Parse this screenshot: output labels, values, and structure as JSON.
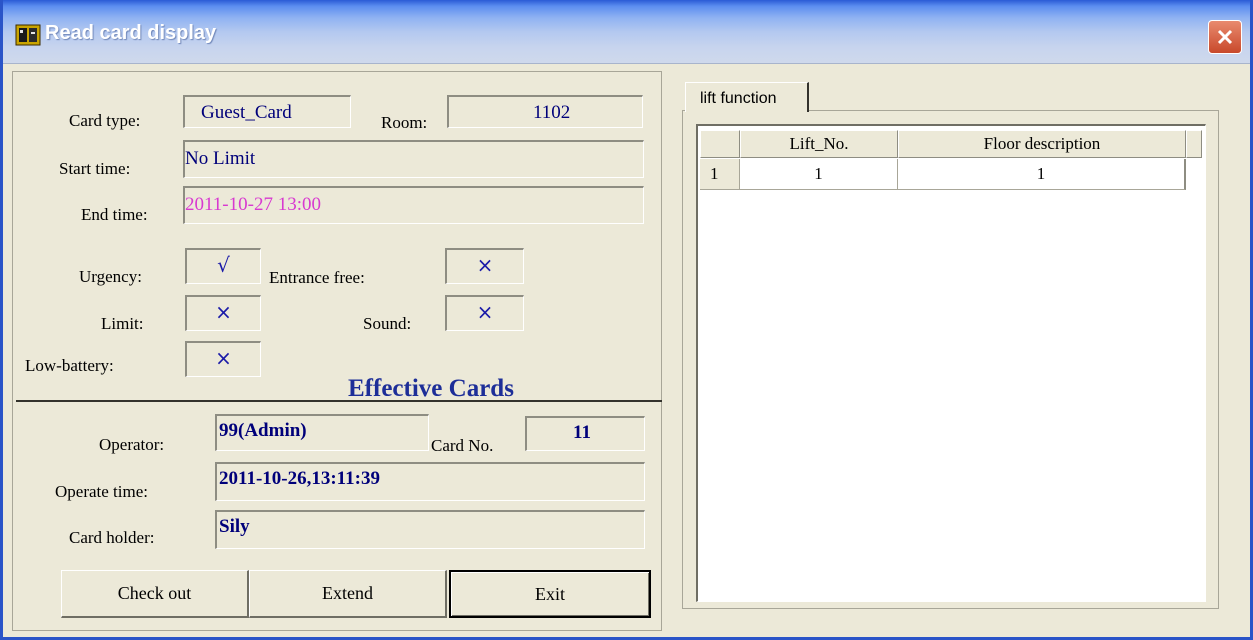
{
  "window": {
    "title": "Read card display"
  },
  "card": {
    "card_type_label": "Card type:",
    "card_type_value": "Guest_Card",
    "room_label": "Room:",
    "room_value": "1102",
    "start_time_label": "Start time:",
    "start_time_value": "No Limit",
    "end_time_label": "End time:",
    "end_time_value": "2011-10-27 13:00",
    "end_time_color": "#d83ad0"
  },
  "flags": {
    "urgency_label": "Urgency:",
    "urgency_value": "√",
    "entrance_free_label": "Entrance free:",
    "entrance_free_value": "×",
    "limit_label": "Limit:",
    "limit_value": "×",
    "sound_label": "Sound:",
    "sound_value": "×",
    "low_battery_label": "Low-battery:",
    "low_battery_value": "×"
  },
  "status": {
    "effective_text": "Effective Cards"
  },
  "operation": {
    "operator_label": "Operator:",
    "operator_value": "99(Admin)",
    "card_no_label": "Card No.",
    "card_no_value": "11",
    "operate_time_label": "Operate time:",
    "operate_time_value": "2011-10-26,13:11:39",
    "card_holder_label": "Card holder:",
    "card_holder_value": "Sily"
  },
  "buttons": {
    "check_out": "Check out",
    "extend": "Extend",
    "exit": "Exit"
  },
  "lift": {
    "tab_label": "lift function",
    "columns": [
      "Lift_No.",
      "Floor description"
    ],
    "rows": [
      {
        "index": "1",
        "lift_no": "1",
        "floor_description": "1"
      }
    ]
  },
  "icons": {
    "app": "card-reader-icon",
    "close": "close-icon"
  }
}
